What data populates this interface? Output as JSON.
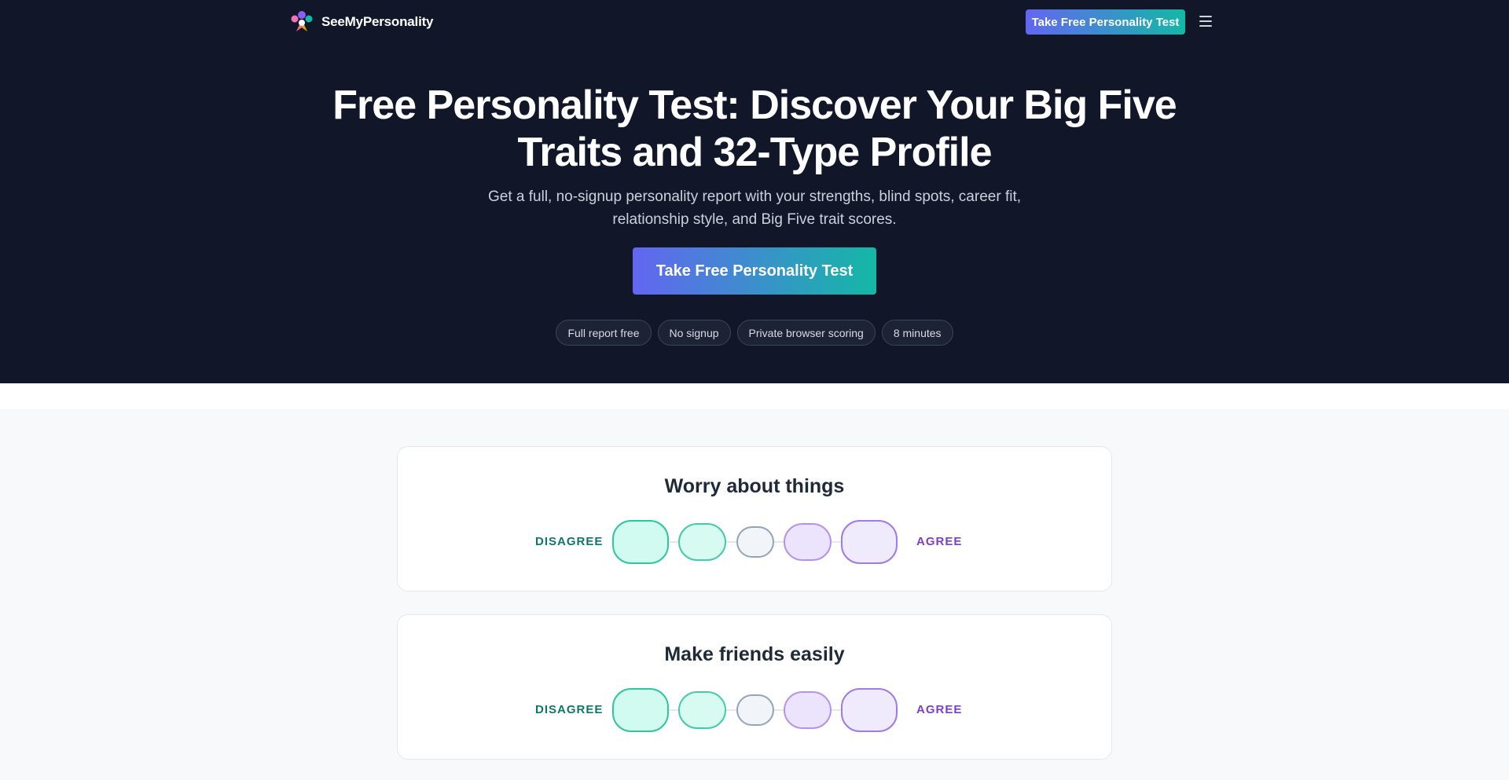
{
  "nav": {
    "brand": "SeeMyPersonality",
    "cta_label": "Take Free Personality Test",
    "menu_icon": "hamburger-menu-icon"
  },
  "hero": {
    "title": "Free Personality Test: Discover Your Big Five Traits and 32-Type Profile",
    "subtitle": "Get a full, no-signup personality report with your strengths, blind spots, career fit, relationship style, and Big Five trait scores.",
    "cta_label": "Take Free Personality Test",
    "chips": [
      "Full report free",
      "No signup",
      "Private browser scoring",
      "8 minutes"
    ]
  },
  "questions": [
    {
      "statement": "Worry about things",
      "disagree_label": "DISAGREE",
      "agree_label": "AGREE"
    },
    {
      "statement": "Make friends easily",
      "disagree_label": "DISAGREE",
      "agree_label": "AGREE"
    }
  ],
  "colors": {
    "hero_bg": "#111729",
    "gradient_start": "#6366f1",
    "gradient_end": "#14b8a6",
    "disagree": "#0f766e",
    "agree": "#7e3fbf"
  }
}
